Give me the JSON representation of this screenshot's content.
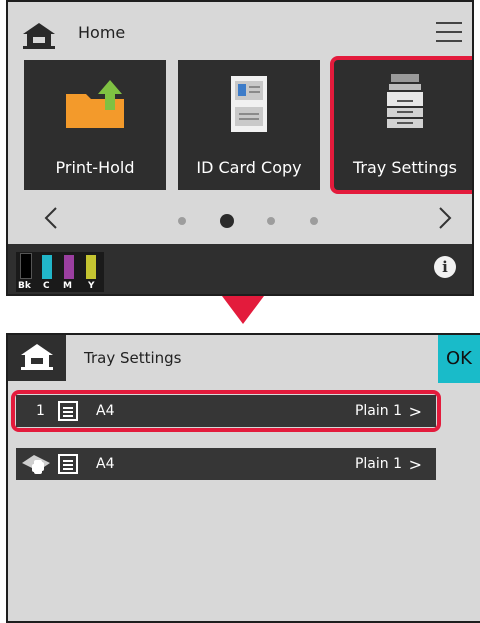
{
  "top_panel": {
    "title": "Home",
    "tiles": [
      {
        "label": "Print-Hold"
      },
      {
        "label": "ID Card Copy"
      },
      {
        "label": "Tray Settings"
      }
    ],
    "pager": {
      "pages": 4,
      "active_page": 2
    },
    "toner": [
      {
        "label": "Bk",
        "color": "#000000"
      },
      {
        "label": "C",
        "color": "#21b6c9"
      },
      {
        "label": "M",
        "color": "#9b3fa0"
      },
      {
        "label": "Y",
        "color": "#c4c431"
      }
    ]
  },
  "bottom_panel": {
    "title": "Tray Settings",
    "ok_label": "OK",
    "trays": [
      {
        "number": "1",
        "size": "A4",
        "type": "Plain 1",
        "chevron": ">"
      },
      {
        "number": "",
        "size": "A4",
        "type": "Plain 1",
        "chevron": ">"
      }
    ]
  },
  "colors": {
    "highlight": "#e31b3c",
    "ok_button": "#19bbc9",
    "tile_bg": "#2e2e2e",
    "panel_bg": "#d8d8d8"
  }
}
